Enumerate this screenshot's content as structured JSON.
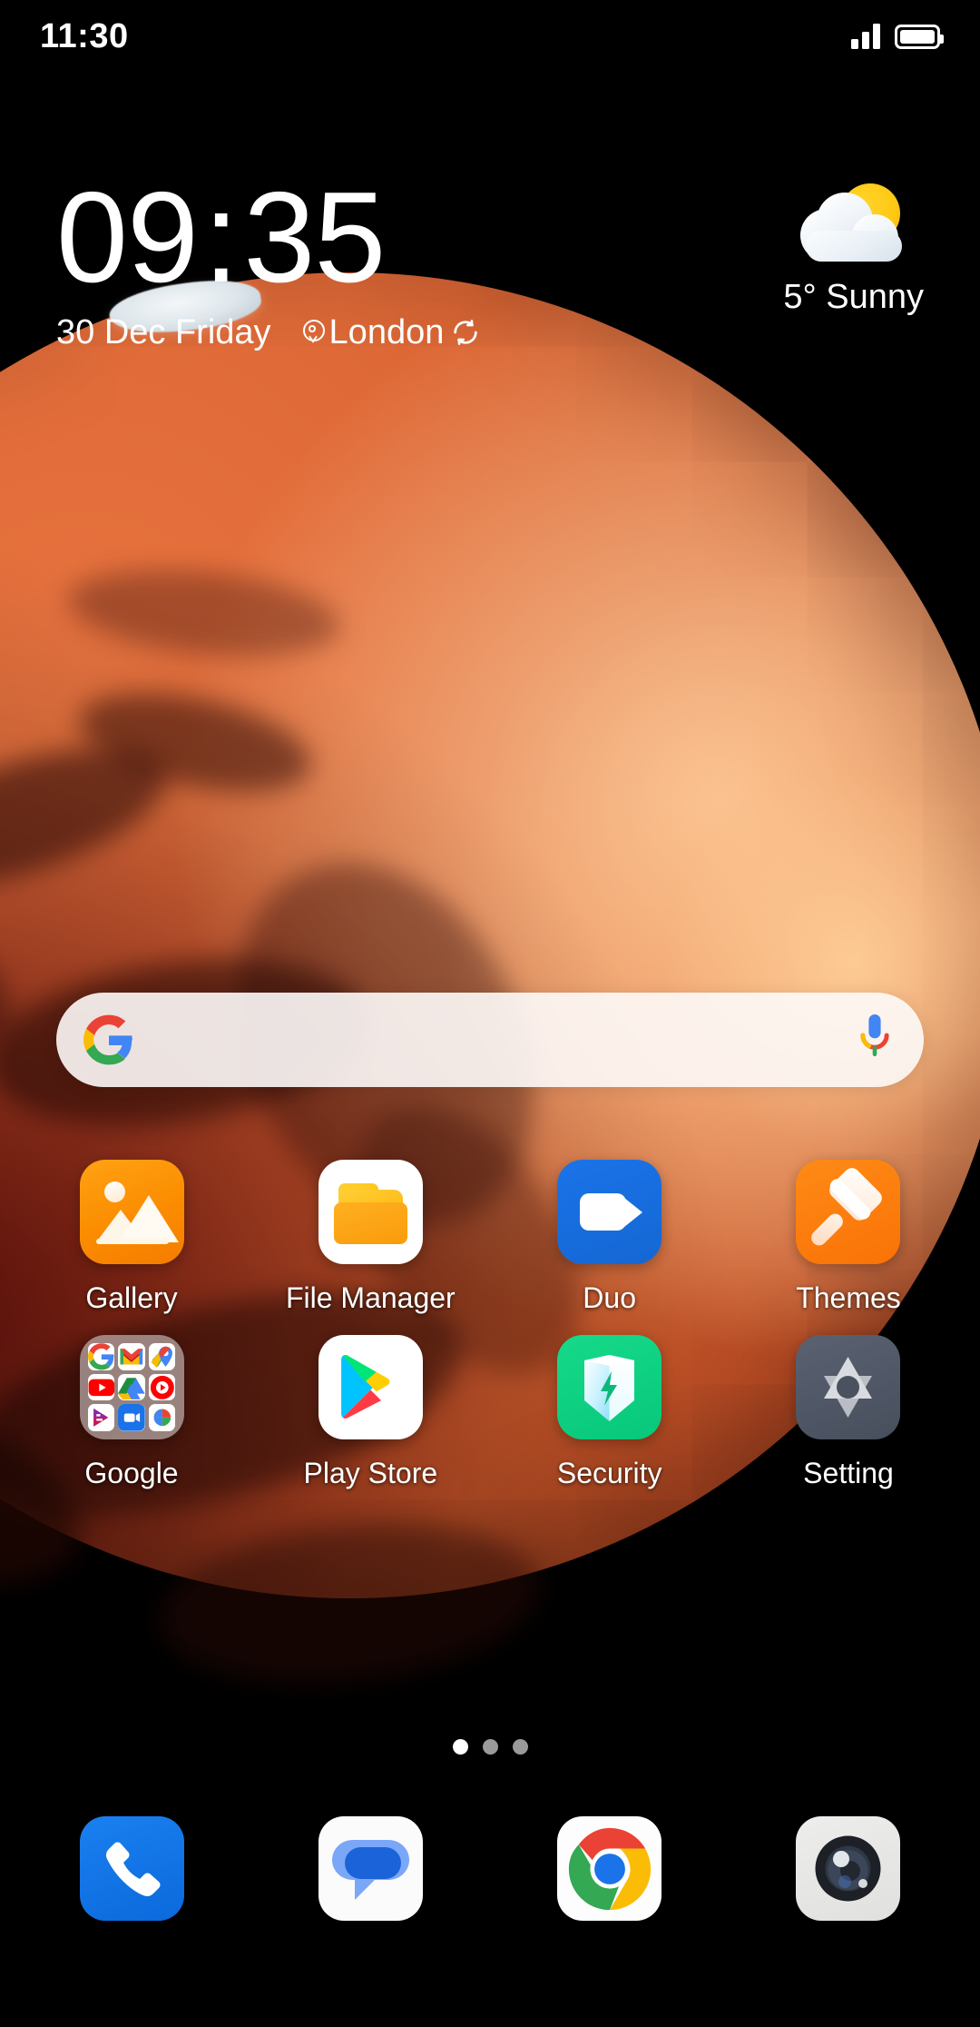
{
  "status_bar": {
    "time": "11:30",
    "signal_icon": "signal-bars-icon",
    "battery_icon": "battery-full-icon"
  },
  "clock_widget": {
    "hours": "09",
    "separator": ":",
    "minutes": "35",
    "date": "30 Dec Friday",
    "location": "London",
    "location_icon": "location-pin-icon",
    "sync_icon": "refresh-sync-icon"
  },
  "weather": {
    "icon": "sun-behind-cloud-icon",
    "text": "5° Sunny",
    "temperature": "5°",
    "condition": "Sunny",
    "sun_color": "#FFC916",
    "cloud_color": "#FFFFFF"
  },
  "search": {
    "google_icon": "google-g-icon",
    "mic_icon": "microphone-icon",
    "placeholder": "",
    "value": ""
  },
  "app_grid": {
    "rows": [
      [
        {
          "label": "Gallery",
          "icon": "gallery-icon",
          "color": "#FB8C00"
        },
        {
          "label": "File Manager",
          "icon": "file-manager-icon",
          "color": "#FFFFFF"
        },
        {
          "label": "Duo",
          "icon": "duo-icon",
          "color": "#1A73E8"
        },
        {
          "label": "Themes",
          "icon": "themes-icon",
          "color": "#F97206"
        }
      ],
      [
        {
          "label": "Google",
          "icon": "google-folder-icon",
          "color": "#DEDEDE"
        },
        {
          "label": "Play Store",
          "icon": "play-store-icon",
          "color": "#FFFFFF"
        },
        {
          "label": "Security",
          "icon": "security-icon",
          "color": "#07C87A"
        },
        {
          "label": "Setting",
          "icon": "setting-icon",
          "color": "#474E5C"
        }
      ]
    ],
    "google_folder_apps": [
      "google-search-icon",
      "gmail-icon",
      "maps-icon",
      "youtube-icon",
      "drive-icon",
      "youtube-music-icon",
      "play-movies-icon",
      "meet-icon",
      "photos-icon"
    ]
  },
  "page_indicator": {
    "total": 3,
    "active_index": 0
  },
  "dock": {
    "items": [
      {
        "label": "Phone",
        "icon": "phone-icon",
        "color": "#0B69DC"
      },
      {
        "label": "Messages",
        "icon": "messages-icon",
        "color": "#FFFFFF"
      },
      {
        "label": "Chrome",
        "icon": "chrome-icon",
        "color": "#FFFFFF"
      },
      {
        "label": "Camera",
        "icon": "camera-icon",
        "color": "#E0E0DE"
      }
    ]
  },
  "wallpaper": {
    "subject": "mars-planet-wallpaper",
    "background_color": "#000000",
    "planet_color": "#D4602F"
  }
}
